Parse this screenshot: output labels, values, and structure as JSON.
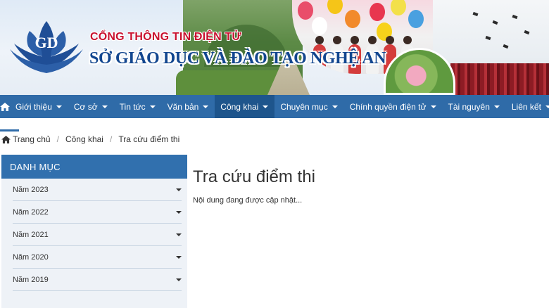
{
  "header": {
    "portal_title": "CỔNG THÔNG TIN ĐIỆN TỬ",
    "org_name": "SỞ GIÁO DỤC VÀ ĐÀO TẠO NGHỆ AN"
  },
  "nav": {
    "home_icon": "home-icon",
    "items": [
      {
        "label": "Giới thiệu",
        "active": false
      },
      {
        "label": "Cơ sở",
        "active": false
      },
      {
        "label": "Tin tức",
        "active": false
      },
      {
        "label": "Văn bản",
        "active": false
      },
      {
        "label": "Công khai",
        "active": true
      },
      {
        "label": "Chuyên mục",
        "active": false
      },
      {
        "label": "Chính quyền điện tử",
        "active": false
      },
      {
        "label": "Tài nguyên",
        "active": false
      },
      {
        "label": "Liên kết",
        "active": false
      }
    ]
  },
  "breadcrumb": {
    "home": "Trang chủ",
    "section": "Công khai",
    "current": "Tra cứu điểm thi"
  },
  "sidebar": {
    "title": "DANH MỤC",
    "items": [
      {
        "label": "Năm 2023"
      },
      {
        "label": "Năm 2022"
      },
      {
        "label": "Năm 2021"
      },
      {
        "label": "Năm 2020"
      },
      {
        "label": "Năm 2019"
      }
    ]
  },
  "main": {
    "title": "Tra cứu điểm thi",
    "content": "Nội dung đang được cập nhật..."
  },
  "colors": {
    "nav_bg": "#2f6ba8",
    "nav_active": "#1e558c",
    "sidebar_head": "#3170ae",
    "sidebar_bg": "#eef2f7",
    "title_red": "#c8102e",
    "title_blue": "#12468f"
  }
}
